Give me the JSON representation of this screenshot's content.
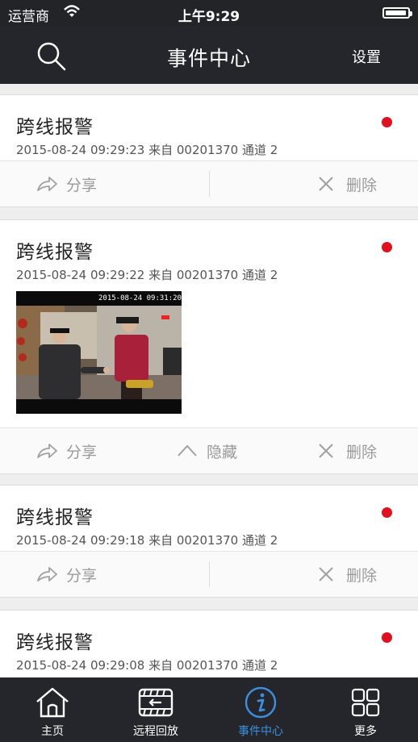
{
  "status_bar": {
    "carrier": "运营商",
    "time": "上午9:29",
    "battery_level": 0.95
  },
  "header": {
    "title": "事件中心",
    "settings_label": "设置",
    "search_icon": "search-icon"
  },
  "events": [
    {
      "title": "跨线报警",
      "timestamp": "2015-08-24 09:29:23",
      "source": "来自 00201370",
      "channel": "通道 2",
      "status_color": "#e0101e",
      "has_image": false,
      "share_label": "分享",
      "delete_label": "删除"
    },
    {
      "title": "跨线报警",
      "timestamp": "2015-08-24 09:29:22",
      "source": "来自 00201370",
      "channel": "通道 2",
      "status_color": "#e0101e",
      "has_image": true,
      "image_overlay": "2015-08-24  09:31:20",
      "share_label": "分享",
      "hide_label": "隐藏",
      "delete_label": "删除"
    },
    {
      "title": "跨线报警",
      "timestamp": "2015-08-24 09:29:18",
      "source": "来自 00201370",
      "channel": "通道 2",
      "status_color": "#e0101e",
      "has_image": false,
      "share_label": "分享",
      "delete_label": "删除"
    },
    {
      "title": "跨线报警",
      "timestamp": "2015-08-24 09:29:08",
      "source": "来自 00201370",
      "channel": "通道 2",
      "status_color": "#e0101e",
      "has_image": false
    }
  ],
  "tab_bar": {
    "items": [
      {
        "label": "主页",
        "icon": "home-icon"
      },
      {
        "label": "远程回放",
        "icon": "playback-icon"
      },
      {
        "label": "事件中心",
        "icon": "info-icon",
        "active": true
      },
      {
        "label": "更多",
        "icon": "grid-icon"
      }
    ],
    "active_color": "#3c90e0"
  }
}
